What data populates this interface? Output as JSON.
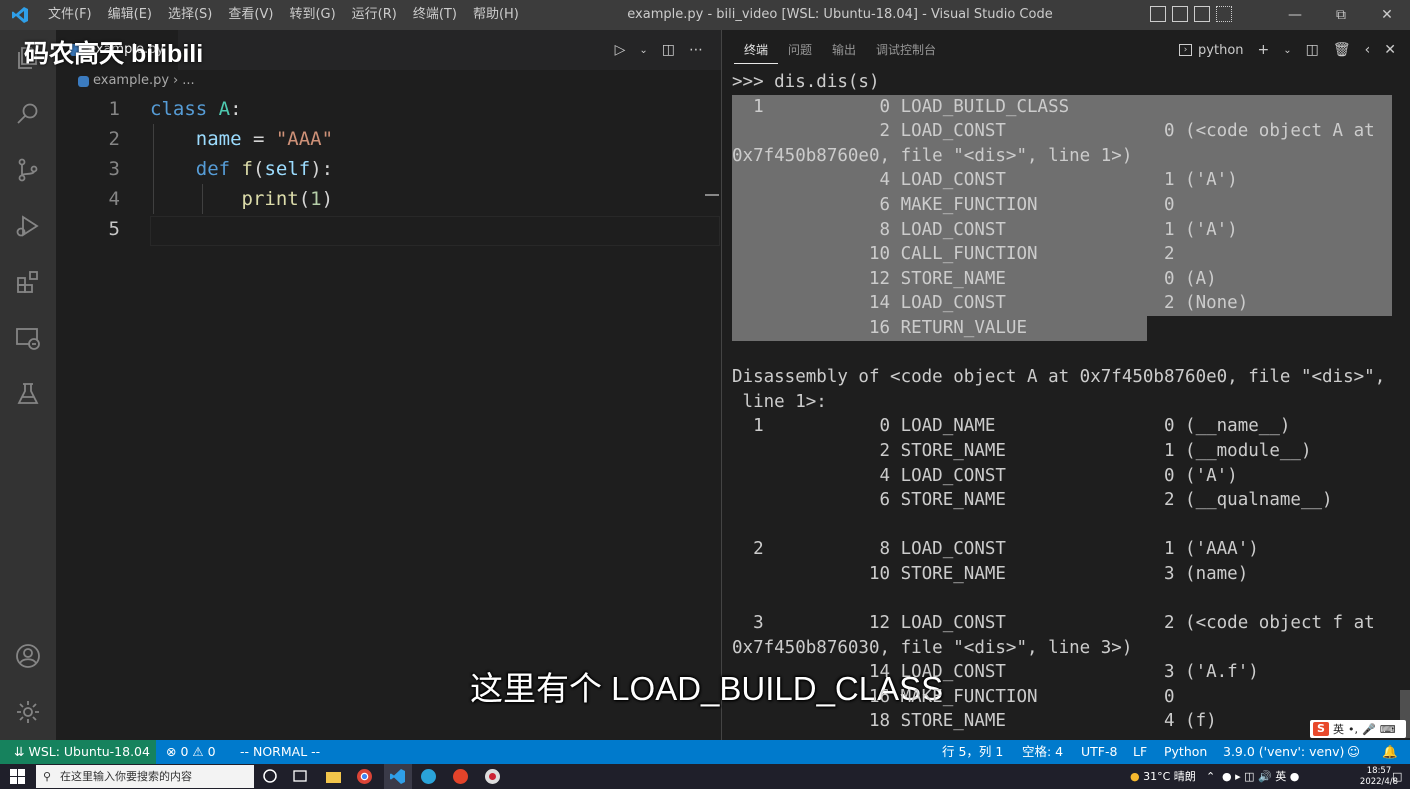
{
  "titlebar": {
    "menu": [
      "文件(F)",
      "编辑(E)",
      "选择(S)",
      "查看(V)",
      "转到(G)",
      "运行(R)",
      "终端(T)",
      "帮助(H)"
    ],
    "window_title": "example.py - bili_video [WSL: Ubuntu-18.04] - Visual Studio Code"
  },
  "editor": {
    "tab_label": "example.py",
    "breadcrumb_file": "example.py",
    "breadcrumb_rest": "...",
    "line_numbers": [
      "1",
      "2",
      "3",
      "4",
      "5"
    ],
    "code": {
      "l1_kw": "class",
      "l1_name": "A",
      "l1_colon": ":",
      "l2_var": "name",
      "l2_eq": " = ",
      "l2_str": "\"AAA\"",
      "l3_kw": "def",
      "l3_fn": "f",
      "l3_open": "(",
      "l3_param": "self",
      "l3_close": "):",
      "l4_fn": "print",
      "l4_open": "(",
      "l4_num": "1",
      "l4_close": ")"
    }
  },
  "panel": {
    "tabs": [
      "终端",
      "问题",
      "输出",
      "调试控制台"
    ],
    "terminal_select": "python",
    "lines": [
      ">>> dis.dis(s)",
      "  1           0 LOAD_BUILD_CLASS",
      "              2 LOAD_CONST               0 (<code object A at",
      "0x7f450b8760e0, file \"<dis>\", line 1>)",
      "              4 LOAD_CONST               1 ('A')",
      "              6 MAKE_FUNCTION            0",
      "              8 LOAD_CONST               1 ('A')",
      "             10 CALL_FUNCTION            2",
      "             12 STORE_NAME               0 (A)",
      "             14 LOAD_CONST               2 (None)",
      "             16 RETURN_VALUE",
      "",
      "Disassembly of <code object A at 0x7f450b8760e0, file \"<dis>\",",
      " line 1>:",
      "  1           0 LOAD_NAME                0 (__name__)",
      "              2 STORE_NAME               1 (__module__)",
      "              4 LOAD_CONST               0 ('A')",
      "              6 STORE_NAME               2 (__qualname__)",
      "",
      "  2           8 LOAD_CONST               1 ('AAA')",
      "             10 STORE_NAME               3 (name)",
      "",
      "  3          12 LOAD_CONST               2 (<code object f at",
      "0x7f450b876030, file \"<dis>\", line 3>)",
      "             14 LOAD_CONST               3 ('A.f')",
      "             16 MAKE_FUNCTION            0",
      "             18 STORE_NAME               4 (f)"
    ]
  },
  "overlay": {
    "subtitle": "这里有个 LOAD_BUILD_CLASS",
    "watermark": "码农高天 bilibili"
  },
  "statusbar": {
    "remote": "WSL: Ubuntu-18.04",
    "errors": "0",
    "warnings": "0",
    "mode": "-- NORMAL --",
    "position": "行 5，列 1",
    "spaces": "空格: 4",
    "encoding": "UTF-8",
    "eol": "LF",
    "language": "Python",
    "interpreter": "3.9.0 ('venv': venv)"
  },
  "taskbar": {
    "search_placeholder": "在这里输入你要搜索的内容",
    "weather": "31°C 晴朗",
    "ime_lang": "英",
    "time": "18:57",
    "date": "2022/4/8"
  },
  "ime": {
    "label": "英"
  },
  "colors": {
    "statusbar": "#007acc",
    "remote": "#16825d",
    "selection": "#6f6f6f"
  }
}
